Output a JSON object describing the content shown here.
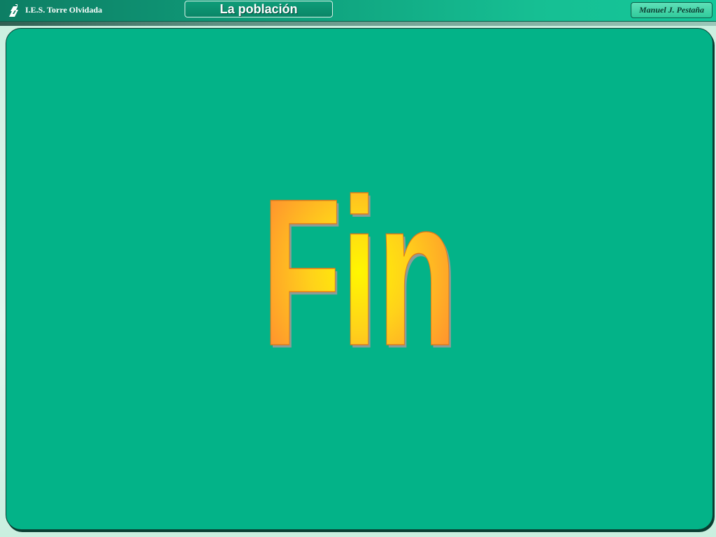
{
  "header": {
    "school": "I.E.S. Torre Olvidada",
    "title": "La población",
    "author": "Manuel J. Pestaña",
    "logo_icon": "tower-logo-icon"
  },
  "main": {
    "word": "Fin"
  },
  "colors": {
    "panel": "#03b388",
    "header_start": "#0d7e64",
    "header_end": "#14c79a",
    "word_center": "#fff200",
    "word_edge": "#ff9a2e"
  }
}
